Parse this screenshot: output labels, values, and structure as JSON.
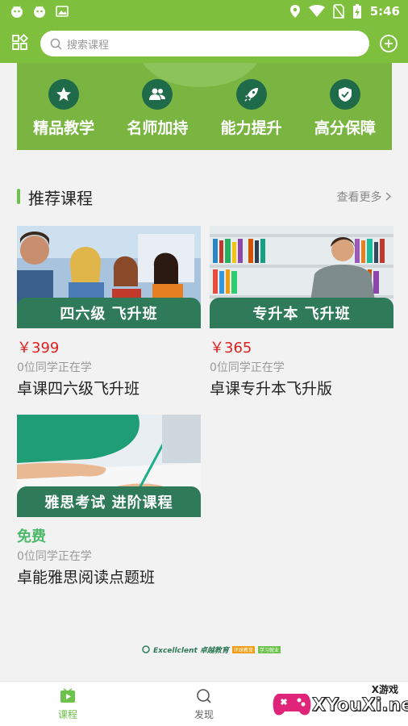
{
  "status_bar": {
    "time": "5:46"
  },
  "search": {
    "placeholder": "搜索课程"
  },
  "banner": {
    "features": [
      {
        "label": "精品教学",
        "icon": "star-icon"
      },
      {
        "label": "名师加持",
        "icon": "people-icon"
      },
      {
        "label": "能力提升",
        "icon": "rocket-icon"
      },
      {
        "label": "高分保障",
        "icon": "shield-icon"
      }
    ]
  },
  "section": {
    "title": "推荐课程",
    "more": "查看更多"
  },
  "courses": [
    {
      "ribbon": "四六级 飞升班",
      "price": "￥399",
      "students": "0位同学正在学",
      "name": "卓课四六级飞升班"
    },
    {
      "ribbon": "专升本 飞升班",
      "price": "￥365",
      "students": "0位同学正在学",
      "name": "卓课专升本飞升版"
    },
    {
      "ribbon": "雅思考试 进阶课程",
      "price": "免费",
      "students": "0位同学正在学",
      "name": "卓能雅思阅读点题班"
    }
  ],
  "footer_logo": {
    "brand": "Excellclent 卓越教育",
    "tag1": "环球教育",
    "tag2": "学习就业"
  },
  "tabs": [
    {
      "label": "课程",
      "icon": "play-icon",
      "active": true
    },
    {
      "label": "发现",
      "icon": "search-icon",
      "active": false
    }
  ],
  "watermark": {
    "text": "XYouXi.net",
    "small": "X游戏"
  },
  "colors": {
    "brand_green": "#7fbf3e",
    "dark_green": "#2f7a58",
    "price_red": "#e02020",
    "free_green": "#4cb86a"
  }
}
